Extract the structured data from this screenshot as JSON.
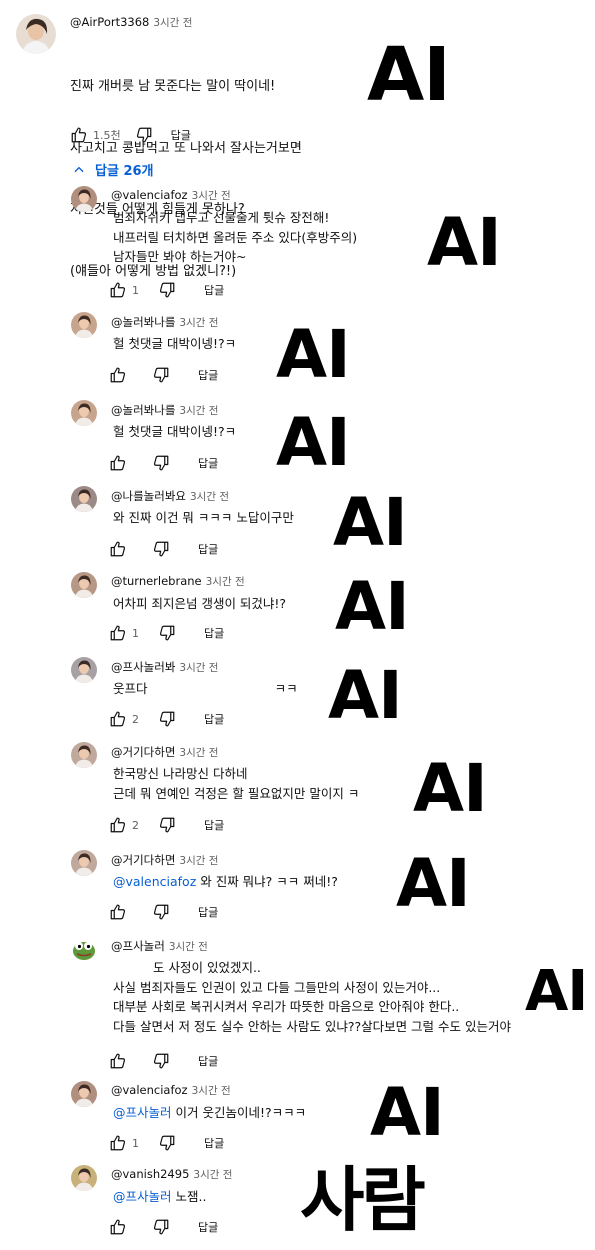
{
  "top_comment": {
    "author": "@AirPort3368",
    "time": "3시간 전",
    "lines": [
      "진짜 개버릇 남 못준다는 말이 딱이네!",
      "사고치고 콩밥먹고 또 나와서 잘사는거보면",
      "저런것들 어떻게 힘들게 못하나?",
      "(얘들아 어떻게 방법 없겠니?!)"
    ],
    "likes": "1.5천",
    "reply_label": "답글",
    "avatar_color": "#c9a58a"
  },
  "replies_toggle": {
    "label": "답글 26개"
  },
  "replies": [
    {
      "author": "@valenciafoz",
      "time": "3시간 전",
      "lines": [
        "범죄자쉬키 냅두고 선물줄게 튓슈 장전해!",
        "내프러릴 터치하면 올려둔 주소 있다(후방주의)",
        "남자들만 봐야 하는거야~"
      ],
      "likes": "1",
      "reply_label": "답글",
      "stamp": "AI",
      "avatar_color": "#b08f7e"
    },
    {
      "author": "@놀러봐나를",
      "time": "3시간 전",
      "lines": [
        "헐 첫댓글 대박이넹!?ㅋ"
      ],
      "likes": "",
      "reply_label": "답글",
      "stamp": "AI",
      "avatar_color": "#c7a48c"
    },
    {
      "author": "@놀러봐나를",
      "time": "3시간 전",
      "lines": [
        "헐 첫댓글 대박이넹!?ㅋ"
      ],
      "likes": "",
      "reply_label": "답글",
      "stamp": "AI",
      "avatar_color": "#c7a48c"
    },
    {
      "author": "@나를놀러봐요",
      "time": "3시간 전",
      "lines": [
        "와 진짜 이건 뭐 ㅋㅋㅋ 노답이구만"
      ],
      "likes": "",
      "reply_label": "답글",
      "stamp": "AI",
      "avatar_color": "#9c8a86"
    },
    {
      "author": "@turnerlebrane",
      "time": "3시간 전",
      "lines": [
        "어차피 죄지은넘 갱생이 되겄냐!?"
      ],
      "likes": "1",
      "reply_label": "답글",
      "stamp": "AI",
      "avatar_color": "#b79785"
    },
    {
      "author": "@프사놀러봐",
      "time": "3시간 전",
      "lines": [
        "웃프다                                ㅋㅋ"
      ],
      "likes": "2",
      "reply_label": "답글",
      "stamp": "AI",
      "avatar_color": "#a7a0a4"
    },
    {
      "author": "@거기다하면",
      "time": "3시간 전",
      "lines": [
        "한국망신 나라망신 다하네",
        "근데 뭐 연예인 걱정은 할 필요없지만 말이지 ㅋ"
      ],
      "likes": "2",
      "reply_label": "답글",
      "stamp": "AI",
      "avatar_color": "#c0a89c"
    },
    {
      "author": "@거기다하면",
      "time": "3시간 전",
      "mention": "@valenciafoz",
      "lines": [
        " 와 진짜 뭐냐? ㅋㅋ 쩌네!?"
      ],
      "likes": "",
      "reply_label": "답글",
      "stamp": "AI",
      "avatar_color": "#c0a89c"
    },
    {
      "author": "@프사놀러",
      "time": "3시간 전",
      "lines": [
        "도 사정이 있었겠지..",
        "사실 범죄자들도 인권이 있고 다들 그들만의 사정이 있는거야...",
        "대부분 사회로 복귀시켜서 우리가 따뜻한 마음으로 안아줘야 한다..",
        "다들 살면서 저 정도 실수 안하는 사람도 있냐??살다보면 그럴 수도 있는거야"
      ],
      "likes": "",
      "reply_label": "답글",
      "stamp": "AI",
      "avatar_color": "#5a8a3c"
    },
    {
      "author": "@valenciafoz",
      "time": "3시간 전",
      "mention": "@프사놀러",
      "lines": [
        " 이거 웃긴놈이네!?ㅋㅋㅋ"
      ],
      "likes": "1",
      "reply_label": "답글",
      "stamp": "AI",
      "avatar_color": "#b08f7e"
    },
    {
      "author": "@vanish2495",
      "time": "3시간 전",
      "mention": "@프사놀러",
      "lines": [
        " 노잼.."
      ],
      "likes": "",
      "reply_label": "답글",
      "stamp": "사람",
      "avatar_color": "#c8b27a"
    }
  ],
  "top_stamp": "AI"
}
